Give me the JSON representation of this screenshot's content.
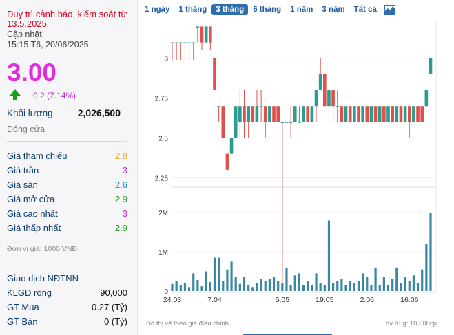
{
  "stock": {
    "alert": "Duy trì cảnh báo, kiểm soát từ 13.5.2025",
    "update_label": "Cập nhật:",
    "update_time": "15:15 T6, 20/06/2025",
    "price": "3.00",
    "change": "0.2 (7.14%)",
    "volume_label": "Khối lượng",
    "volume": "2,026,500",
    "close_label": "Đóng cửa"
  },
  "stats": [
    {
      "label": "Giá tham chiếu",
      "value": "2.8",
      "color": "#e8a21a"
    },
    {
      "label": "Giá trần",
      "value": "3",
      "color": "#d020d0"
    },
    {
      "label": "Giá sàn",
      "value": "2.6",
      "color": "#1c8fc9"
    },
    {
      "label": "Giá mở cửa",
      "value": "2.9",
      "color": "#1c9c1c"
    },
    {
      "label": "Giá cao nhất",
      "value": "3",
      "color": "#d020d0"
    },
    {
      "label": "Giá thấp nhất",
      "value": "2.9",
      "color": "#1c9c1c"
    }
  ],
  "unit_note": "Đơn vị giá: 1000 VNĐ",
  "foreign": {
    "title": "Giao dịch NĐTNN",
    "rows": [
      {
        "label": "KLGD ròng",
        "value": "90,000"
      },
      {
        "label": "GT Mua",
        "value": "0.27 (Tỷ)"
      },
      {
        "label": "GT Bán",
        "value": "0 (Tỷ)"
      }
    ]
  },
  "tabs": [
    "1 ngày",
    "1 tháng",
    "3 tháng",
    "6 tháng",
    "1 năm",
    "3 năm",
    "Tất cả"
  ],
  "active_tab": "3 tháng",
  "chart_icon": "area-chart-icon",
  "colors": {
    "up": "#2a9d8f",
    "down": "#e0504d",
    "volume": "#3a87a3",
    "accent": "#2e6eaf"
  },
  "footer": {
    "left": "Đồ thị vẽ theo giá điều chỉnh",
    "right": "dv KLg: 10,000cp"
  },
  "chart_data": [
    {
      "type": "candlestick",
      "ylim": [
        2.2,
        3.15
      ],
      "y_ticks": [
        "2.25",
        "2.5",
        "2.75",
        "3"
      ],
      "x_ticks": [
        {
          "label": "24.03",
          "index": 0
        },
        {
          "label": "7.04",
          "index": 10
        },
        {
          "label": "5.05",
          "index": 26
        },
        {
          "label": "19.05",
          "index": 36
        },
        {
          "label": "2.06",
          "index": 46
        },
        {
          "label": "16.06",
          "index": 56
        }
      ],
      "candles": [
        {
          "o": 3.1,
          "h": 3.1,
          "l": 2.99,
          "c": 3.1
        },
        {
          "o": 3.1,
          "h": 3.1,
          "l": 2.99,
          "c": 3.1
        },
        {
          "o": 3.1,
          "h": 3.1,
          "l": 2.99,
          "c": 3.1
        },
        {
          "o": 3.1,
          "h": 3.1,
          "l": 2.99,
          "c": 3.1
        },
        {
          "o": 3.1,
          "h": 3.1,
          "l": 2.99,
          "c": 3.1
        },
        {
          "o": 3.1,
          "h": 3.1,
          "l": 2.99,
          "c": 3.1
        },
        {
          "o": 3.2,
          "h": 3.2,
          "l": 3.1,
          "c": 3.2
        },
        {
          "o": 3.2,
          "h": 3.2,
          "l": 3.05,
          "c": 3.1
        },
        {
          "o": 3.1,
          "h": 3.2,
          "l": 3.1,
          "c": 3.2
        },
        {
          "o": 3.2,
          "h": 3.2,
          "l": 3.05,
          "c": 3.1
        },
        {
          "o": 3.0,
          "h": 3.0,
          "l": 2.8,
          "c": 2.8
        },
        {
          "o": 2.7,
          "h": 2.7,
          "l": 2.6,
          "c": 2.7
        },
        {
          "o": 2.7,
          "h": 2.7,
          "l": 2.5,
          "c": 2.5
        },
        {
          "o": 2.4,
          "h": 2.4,
          "l": 2.3,
          "c": 2.3
        },
        {
          "o": 2.4,
          "h": 2.5,
          "l": 2.4,
          "c": 2.5
        },
        {
          "o": 2.5,
          "h": 2.7,
          "l": 2.5,
          "c": 2.7
        },
        {
          "o": 2.6,
          "h": 2.8,
          "l": 2.5,
          "c": 2.7
        },
        {
          "o": 2.7,
          "h": 2.8,
          "l": 2.5,
          "c": 2.6
        },
        {
          "o": 2.6,
          "h": 2.7,
          "l": 2.5,
          "c": 2.7
        },
        {
          "o": 2.7,
          "h": 2.7,
          "l": 2.6,
          "c": 2.6
        },
        {
          "o": 2.6,
          "h": 2.8,
          "l": 2.6,
          "c": 2.7
        },
        {
          "o": 2.7,
          "h": 2.8,
          "l": 2.6,
          "c": 2.7
        },
        {
          "o": 2.7,
          "h": 2.7,
          "l": 2.5,
          "c": 2.6
        },
        {
          "o": 2.6,
          "h": 2.7,
          "l": 2.6,
          "c": 2.7
        },
        {
          "o": 2.7,
          "h": 2.7,
          "l": 2.6,
          "c": 2.6
        },
        {
          "o": 2.7,
          "h": 2.7,
          "l": 2.6,
          "c": 2.6
        },
        {
          "o": 2.6,
          "h": 2.6,
          "l": 1.5,
          "c": 2.6
        },
        {
          "o": 2.6,
          "h": 2.6,
          "l": 2.6,
          "c": 2.6
        },
        {
          "o": 2.6,
          "h": 2.7,
          "l": 2.5,
          "c": 2.6
        },
        {
          "o": 2.6,
          "h": 2.7,
          "l": 2.6,
          "c": 2.7
        },
        {
          "o": 2.6,
          "h": 2.7,
          "l": 2.6,
          "c": 2.6
        },
        {
          "o": 2.6,
          "h": 2.7,
          "l": 2.6,
          "c": 2.7
        },
        {
          "o": 2.7,
          "h": 2.7,
          "l": 2.6,
          "c": 2.6
        },
        {
          "o": 2.6,
          "h": 2.7,
          "l": 2.6,
          "c": 2.7
        },
        {
          "o": 2.7,
          "h": 2.8,
          "l": 2.6,
          "c": 2.8
        },
        {
          "o": 2.8,
          "h": 3.0,
          "l": 2.8,
          "c": 2.9
        },
        {
          "o": 2.9,
          "h": 2.9,
          "l": 2.7,
          "c": 2.7
        },
        {
          "o": 2.7,
          "h": 2.8,
          "l": 2.6,
          "c": 2.8
        },
        {
          "o": 2.8,
          "h": 2.8,
          "l": 2.6,
          "c": 2.7
        },
        {
          "o": 2.7,
          "h": 2.8,
          "l": 2.6,
          "c": 2.7
        },
        {
          "o": 2.7,
          "h": 2.7,
          "l": 2.6,
          "c": 2.6
        },
        {
          "o": 2.6,
          "h": 2.7,
          "l": 2.6,
          "c": 2.7
        },
        {
          "o": 2.7,
          "h": 2.7,
          "l": 2.6,
          "c": 2.6
        },
        {
          "o": 2.6,
          "h": 2.7,
          "l": 2.6,
          "c": 2.7
        },
        {
          "o": 2.7,
          "h": 2.7,
          "l": 2.6,
          "c": 2.6
        },
        {
          "o": 2.6,
          "h": 2.7,
          "l": 2.6,
          "c": 2.7
        },
        {
          "o": 2.7,
          "h": 2.7,
          "l": 2.6,
          "c": 2.6
        },
        {
          "o": 2.6,
          "h": 2.7,
          "l": 2.6,
          "c": 2.7
        },
        {
          "o": 2.7,
          "h": 2.7,
          "l": 2.6,
          "c": 2.6
        },
        {
          "o": 2.6,
          "h": 2.7,
          "l": 2.6,
          "c": 2.7
        },
        {
          "o": 2.7,
          "h": 2.7,
          "l": 2.6,
          "c": 2.6
        },
        {
          "o": 2.6,
          "h": 2.7,
          "l": 2.6,
          "c": 2.7
        },
        {
          "o": 2.7,
          "h": 2.7,
          "l": 2.6,
          "c": 2.6
        },
        {
          "o": 2.6,
          "h": 2.7,
          "l": 2.6,
          "c": 2.7
        },
        {
          "o": 2.7,
          "h": 2.7,
          "l": 2.6,
          "c": 2.6
        },
        {
          "o": 2.6,
          "h": 2.7,
          "l": 2.6,
          "c": 2.7
        },
        {
          "o": 2.7,
          "h": 2.7,
          "l": 2.5,
          "c": 2.6
        },
        {
          "o": 2.6,
          "h": 2.7,
          "l": 2.6,
          "c": 2.7
        },
        {
          "o": 2.7,
          "h": 2.7,
          "l": 2.6,
          "c": 2.6
        },
        {
          "o": 2.7,
          "h": 2.7,
          "l": 2.6,
          "c": 2.6
        },
        {
          "o": 2.7,
          "h": 2.8,
          "l": 2.7,
          "c": 2.8
        },
        {
          "o": 2.9,
          "h": 3.0,
          "l": 2.9,
          "c": 3.0
        }
      ]
    },
    {
      "type": "bar",
      "title": "Volume",
      "ylim": [
        0,
        2300000
      ],
      "y_ticks": [
        "0",
        "1M",
        "2M"
      ],
      "values": [
        180000,
        250000,
        150000,
        200000,
        100000,
        450000,
        280000,
        120000,
        500000,
        230000,
        850000,
        850000,
        250000,
        550000,
        750000,
        350000,
        180000,
        350000,
        150000,
        100000,
        200000,
        300000,
        250000,
        300000,
        350000,
        250000,
        200000,
        600000,
        150000,
        400000,
        450000,
        150000,
        250000,
        150000,
        450000,
        200000,
        150000,
        1800000,
        200000,
        250000,
        300000,
        150000,
        250000,
        200000,
        250000,
        450000,
        350000,
        150000,
        600000,
        150000,
        350000,
        150000,
        300000,
        600000,
        200000,
        350000,
        250000,
        400000,
        200000,
        550000,
        1200000,
        2000000
      ]
    }
  ]
}
